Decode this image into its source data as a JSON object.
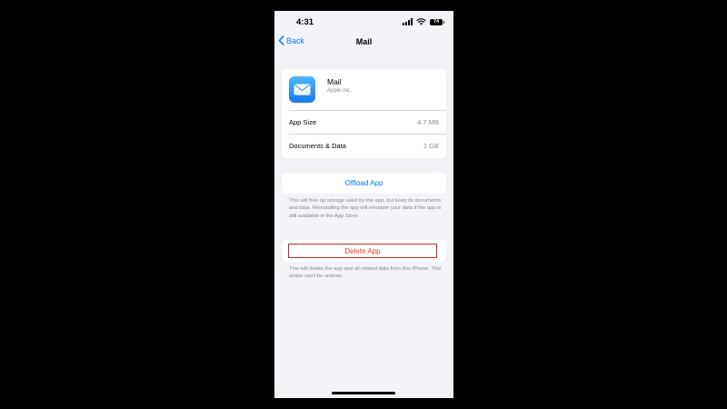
{
  "status": {
    "time": "4:31",
    "battery": "74"
  },
  "nav": {
    "back_label": "Back",
    "title": "Mail"
  },
  "app": {
    "name": "Mail",
    "vendor": "Apple Inc.",
    "icon": "mail-envelope-icon",
    "rows": [
      {
        "label": "App Size",
        "value": "4.7 MB"
      },
      {
        "label": "Documents & Data",
        "value": "1 GB"
      }
    ]
  },
  "offload": {
    "label": "Offload App",
    "note": "This will free up storage used by the app, but keep its documents and data. Reinstalling the app will reinstate your data if the app is still available in the App Store."
  },
  "delete": {
    "label": "Delete App",
    "note": "This will delete the app and all related data from this iPhone. This action can't be undone."
  },
  "colors": {
    "accent": "#0a7aff",
    "destructive": "#e53a33",
    "highlight_border": "#c8262a",
    "background": "#f2f2f7"
  }
}
